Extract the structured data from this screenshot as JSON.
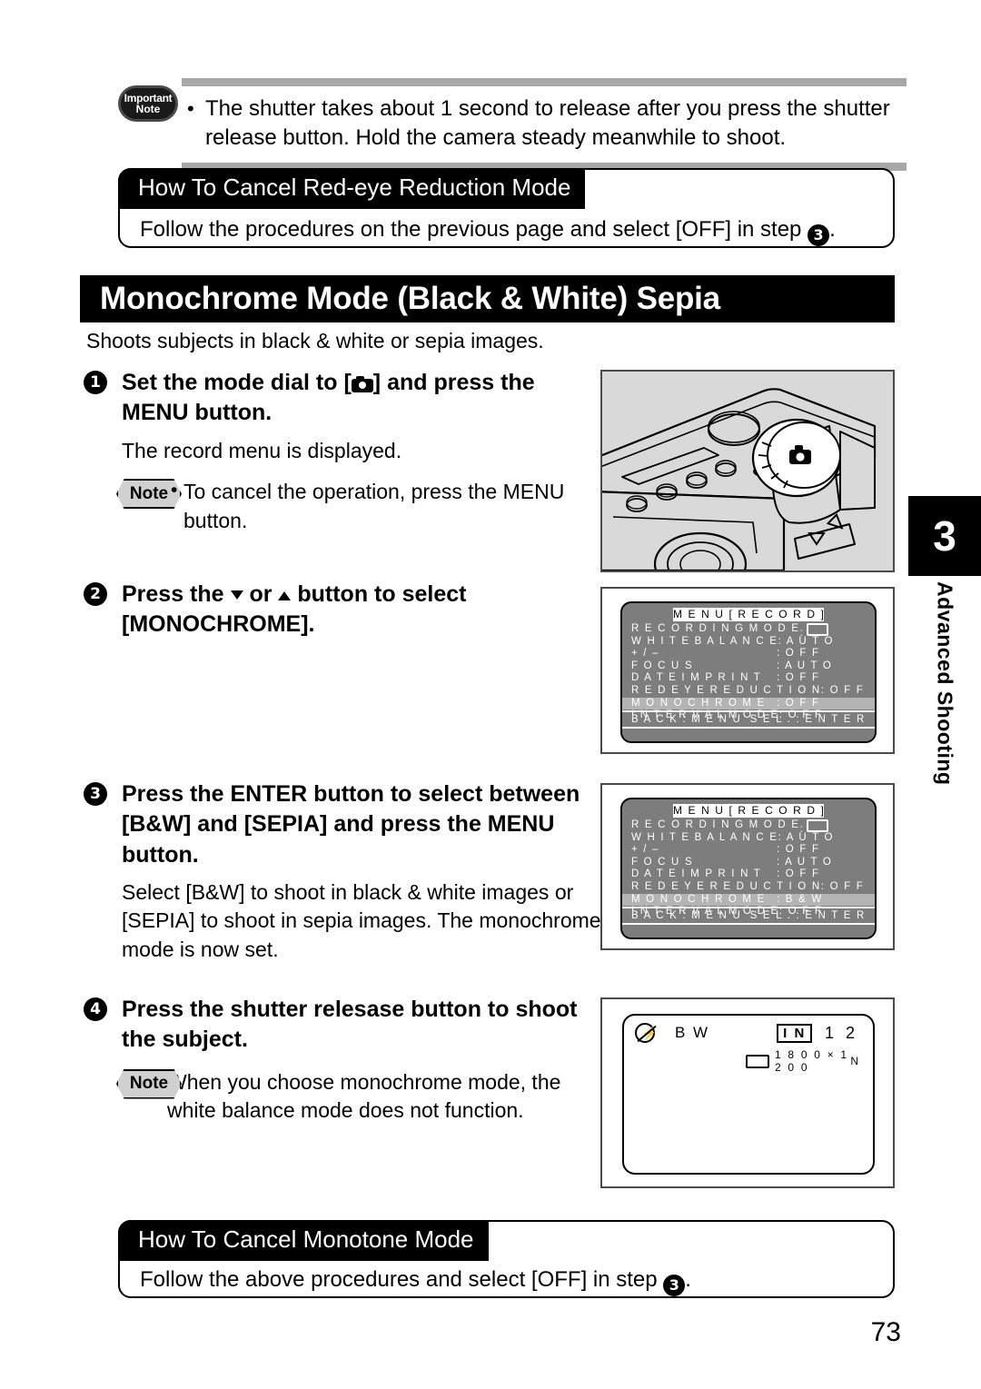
{
  "important_note": {
    "badge_line1": "Important",
    "badge_line2": "Note",
    "bullet": "•",
    "text": "The shutter takes about 1 second to release after you press the shutter release button.  Hold the camera steady meanwhile to shoot."
  },
  "cancel_redeye": {
    "heading": "How To Cancel Red-eye Reduction Mode",
    "body_before": "Follow the procedures on the previous page and select [OFF] in step ",
    "step_marker": "3",
    "body_after": "."
  },
  "main_title": "Monochrome Mode (Black & White) Sepia",
  "intro": "Shoots subjects in black & white or sepia images.",
  "steps": [
    {
      "num": "1",
      "head_part1": "Set the mode dial to [",
      "head_icon": "camera-icon",
      "head_part2": "] and press the MENU button.",
      "body": "The record menu is displayed.",
      "note": {
        "badge": "Note",
        "bullet": "•",
        "text": "To cancel the operation, press the MENU button."
      }
    },
    {
      "num": "2",
      "head_part1": "Press the ",
      "head_icon1": "triangle-down-icon",
      "head_mid": " or ",
      "head_icon2": "triangle-up-icon",
      "head_part2": " button to select [MONOCHROME].",
      "body": "",
      "note": null
    },
    {
      "num": "3",
      "head_part1": "Press the ENTER button to select between [B&W] and [SEPIA] and press the MENU button.",
      "body": "Select [B&W] to shoot in black & white images or [SEPIA] to shoot in sepia images.  The monochrome mode is now set.",
      "note": null
    },
    {
      "num": "4",
      "head_part1": "Press the shutter relesase button to shoot the subject.",
      "body": "",
      "note": {
        "badge": "Note",
        "bullet": "",
        "text": "When you choose monochrome mode, the white balance mode does not function."
      }
    }
  ],
  "lcd_menu_1": {
    "title": "M E N U   [ R E C O R D ]",
    "rows": [
      {
        "label": "R E C O R D I N G   M O D E",
        "value": ":",
        "value_icon": "recording-mode-icon",
        "selected": false
      },
      {
        "label": "W H I T E   B A L A N C E",
        "value": ": A U T O",
        "selected": false
      },
      {
        "label": "+ / –",
        "value": ": O F F",
        "selected": false
      },
      {
        "label": "F O C U S",
        "value": ": A U T O",
        "selected": false
      },
      {
        "label": "D A T E   I M P R I N T",
        "value": ": O F F",
        "selected": false
      },
      {
        "label": "R E D E Y E   R E D U C T I O N",
        "value": ": O F F",
        "selected": false
      },
      {
        "label": "M O N O C H R O M E",
        "value": ": O F F",
        "selected": true
      },
      {
        "label": "I N T E R V A L   M O D E",
        "value": ": O F F",
        "selected": false
      }
    ],
    "footer_left": "B A C K : M E N U",
    "footer_right": "S E L . : E N T E R"
  },
  "lcd_menu_2": {
    "title": "M E N U   [ R E C O R D ]",
    "rows": [
      {
        "label": "R E C O R D I N G   M O D E",
        "value": ":",
        "value_icon": "recording-mode-icon",
        "selected": false
      },
      {
        "label": "W H I T E   B A L A N C E",
        "value": ": A U T O",
        "selected": false
      },
      {
        "label": "+ / –",
        "value": ": O F F",
        "selected": false
      },
      {
        "label": "F O C U S",
        "value": ": A U T O",
        "selected": false
      },
      {
        "label": "D A T E   I M P R I N T",
        "value": ": O F F",
        "selected": false
      },
      {
        "label": "R E D E Y E   R E D U C T I O N",
        "value": ": O F F",
        "selected": false
      },
      {
        "label": "M O N O C H R O M E",
        "value": ": B & W",
        "selected": true
      },
      {
        "label": "I N T E R V A L   M O D E",
        "value": ": O F F",
        "selected": false
      }
    ],
    "footer_left": "B A C K : M E N U",
    "footer_right": "S E L . : E N T E R"
  },
  "lcd_display": {
    "flash_icon": "flash-off-icon",
    "mode": "B W",
    "memory": "I N",
    "shots_remaining": "1 2",
    "size_icon": "image-size-icon",
    "resolution": "1 8 0 0 × 1 2 0 0",
    "quality": "N"
  },
  "cancel_monotone": {
    "heading": "How To Cancel Monotone Mode",
    "body_before": "Follow the above procedures and select [OFF] in step ",
    "step_marker": "3",
    "body_after": "."
  },
  "side_tab": {
    "chapter_number": "3",
    "chapter_label": "Advanced Shooting"
  },
  "page_number": "73"
}
